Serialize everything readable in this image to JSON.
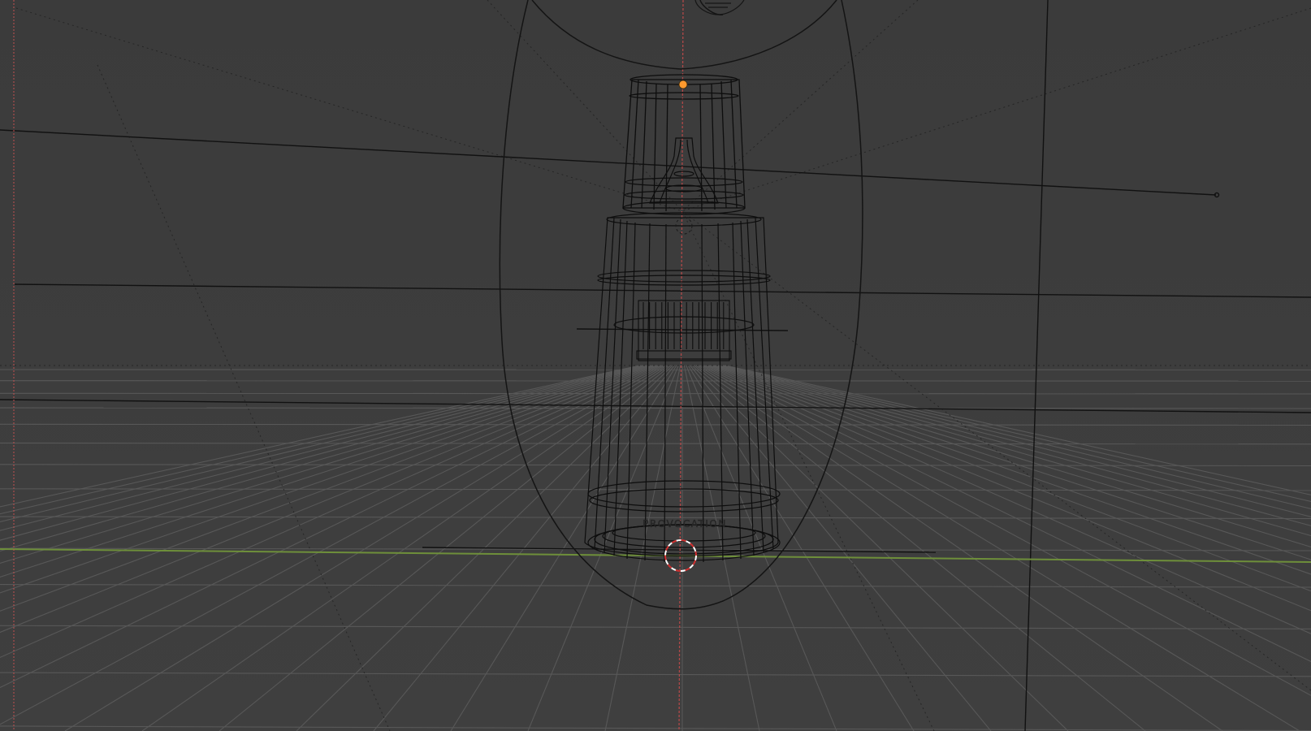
{
  "viewport": {
    "mode": "wireframe",
    "background_color": "#3d3d3d",
    "grid_color": "#5a5a5a",
    "axis_x_color": "#7a9a3a",
    "axis_y_color": "#c85050",
    "wire_color": "#111111",
    "object_origin_color": "#ff9a2e",
    "icons": [
      "3d-cursor-icon",
      "object-origin-icon",
      "camera-lens-icon"
    ]
  },
  "bottle": {
    "label_text": "PROVOCATION"
  }
}
